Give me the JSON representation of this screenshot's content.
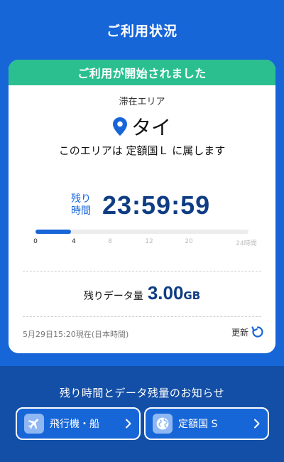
{
  "header": {
    "title": "ご利用状況"
  },
  "status": {
    "banner": "ご利用が開始されました",
    "area_label": "滞在エリア",
    "country": "タイ",
    "belongs_text": "このエリアは 定額国Ｌ に属します"
  },
  "remaining_time": {
    "label_line1": "残り",
    "label_line2": "時間",
    "value": "23:59:59",
    "elapsed_hours": 4,
    "total_hours": 24,
    "ticks": [
      "0",
      "4",
      "8",
      "12",
      "20",
      "24時間"
    ]
  },
  "remaining_data": {
    "label": "残りデータ量",
    "value": "3.00",
    "unit": "GB"
  },
  "footer_info": {
    "timestamp": "5月29日15:20現在(日本時間)",
    "refresh_label": "更新"
  },
  "bottom": {
    "notice": "残り時間とデータ残量のお知らせ",
    "buttons": [
      {
        "label": "飛行機・船",
        "icon": "airplane-icon"
      },
      {
        "label": "定額国 S",
        "icon": "globe-icon"
      }
    ]
  },
  "colors": {
    "primary": "#1766d8",
    "dark_blue": "#0f3d84",
    "banner_green": "#2bbf8f",
    "bottom_bg": "#134fa6"
  }
}
